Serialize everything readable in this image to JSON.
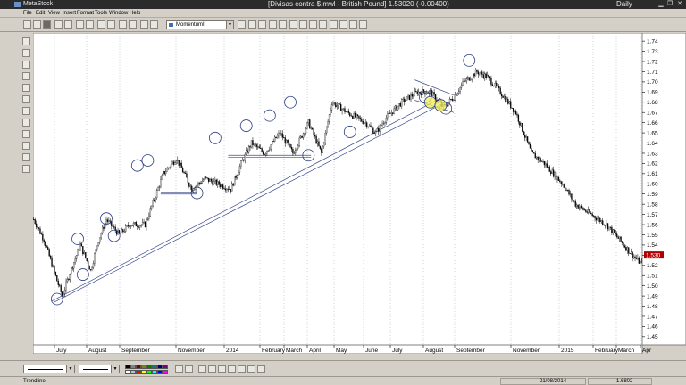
{
  "app": {
    "name": "MetaStock",
    "window_title": "[Divisas contra $.mwl - British Pound]   1.53020 (-0.00400)",
    "period": "Daily"
  },
  "menu": [
    "File",
    "Edit",
    "View",
    "Insert",
    "Format",
    "Tools",
    "Window",
    "Help"
  ],
  "toolbar": {
    "indicator_select": "MomentumI"
  },
  "chart_data": {
    "type": "candlestick",
    "symbol": "British Pound",
    "y_ticks": [
      "1.74",
      "1.73",
      "1.72",
      "1.71",
      "1.70",
      "1.69",
      "1.68",
      "1.67",
      "1.66",
      "1.65",
      "1.64",
      "1.63",
      "1.62",
      "1.61",
      "1.60",
      "1.59",
      "1.58",
      "1.57",
      "1.56",
      "1.55",
      "1.54",
      "1.53",
      "1.52",
      "1.51",
      "1.50",
      "1.49",
      "1.48",
      "1.47",
      "1.46",
      "1.45"
    ],
    "ylim": [
      1.442,
      1.748
    ],
    "x_labels": [
      "July",
      "August",
      "September",
      "November",
      "2014",
      "February",
      "March",
      "April",
      "May",
      "June",
      "July",
      "August",
      "September",
      "November",
      "2015",
      "February",
      "March",
      "Apr"
    ],
    "last_price_label": "1.530",
    "last_price": 1.5302,
    "bar_count": 470,
    "keypoints": [
      [
        0,
        1.565
      ],
      [
        8,
        1.545
      ],
      [
        18,
        1.505
      ],
      [
        22,
        1.49
      ],
      [
        30,
        1.52
      ],
      [
        36,
        1.54
      ],
      [
        44,
        1.515
      ],
      [
        50,
        1.545
      ],
      [
        56,
        1.565
      ],
      [
        66,
        1.55
      ],
      [
        74,
        1.56
      ],
      [
        86,
        1.56
      ],
      [
        100,
        1.61
      ],
      [
        110,
        1.625
      ],
      [
        122,
        1.595
      ],
      [
        132,
        1.605
      ],
      [
        142,
        1.6
      ],
      [
        152,
        1.595
      ],
      [
        160,
        1.62
      ],
      [
        168,
        1.64
      ],
      [
        178,
        1.63
      ],
      [
        190,
        1.65
      ],
      [
        200,
        1.63
      ],
      [
        212,
        1.66
      ],
      [
        222,
        1.63
      ],
      [
        230,
        1.68
      ],
      [
        242,
        1.67
      ],
      [
        256,
        1.66
      ],
      [
        264,
        1.65
      ],
      [
        272,
        1.665
      ],
      [
        284,
        1.68
      ],
      [
        296,
        1.69
      ],
      [
        306,
        1.69
      ],
      [
        316,
        1.675
      ],
      [
        324,
        1.685
      ],
      [
        332,
        1.7
      ],
      [
        342,
        1.71
      ],
      [
        350,
        1.705
      ],
      [
        360,
        1.69
      ],
      [
        372,
        1.67
      ],
      [
        384,
        1.63
      ],
      [
        394,
        1.62
      ],
      [
        408,
        1.6
      ],
      [
        418,
        1.58
      ],
      [
        430,
        1.57
      ],
      [
        442,
        1.56
      ],
      [
        452,
        1.545
      ],
      [
        462,
        1.53
      ],
      [
        470,
        1.52
      ],
      [
        482,
        1.51
      ],
      [
        494,
        1.51
      ],
      [
        506,
        1.52
      ],
      [
        518,
        1.53
      ],
      [
        528,
        1.54
      ],
      [
        536,
        1.51
      ],
      [
        542,
        1.49
      ],
      [
        548,
        1.48
      ]
    ],
    "peak_circles": [
      {
        "date_index": 18,
        "price": 1.487
      },
      {
        "date_index": 34,
        "price": 1.546
      },
      {
        "date_index": 38,
        "price": 1.511
      },
      {
        "date_index": 56,
        "price": 1.566
      },
      {
        "date_index": 62,
        "price": 1.549
      },
      {
        "date_index": 80,
        "price": 1.618
      },
      {
        "date_index": 88,
        "price": 1.623
      },
      {
        "date_index": 126,
        "price": 1.591
      },
      {
        "date_index": 140,
        "price": 1.645
      },
      {
        "date_index": 164,
        "price": 1.657
      },
      {
        "date_index": 182,
        "price": 1.667
      },
      {
        "date_index": 198,
        "price": 1.68
      },
      {
        "date_index": 212,
        "price": 1.628
      },
      {
        "date_index": 244,
        "price": 1.651
      },
      {
        "date_index": 302,
        "price": 1.685
      },
      {
        "date_index": 318,
        "price": 1.674
      },
      {
        "date_index": 336,
        "price": 1.721
      }
    ],
    "yellow_markers": [
      {
        "date_index": 306,
        "price": 1.68
      },
      {
        "date_index": 314,
        "price": 1.677
      }
    ],
    "trendlines": [
      {
        "from": [
          14,
          1.485
        ],
        "to": [
          314,
          1.684
        ]
      },
      {
        "from": [
          16,
          1.484
        ],
        "to": [
          316,
          1.679
        ]
      },
      {
        "from": [
          98,
          1.592
        ],
        "to": [
          126,
          1.592
        ]
      },
      {
        "from": [
          98,
          1.59
        ],
        "to": [
          126,
          1.59
        ]
      },
      {
        "from": [
          150,
          1.628
        ],
        "to": [
          214,
          1.628
        ]
      },
      {
        "from": [
          150,
          1.626
        ],
        "to": [
          214,
          1.626
        ]
      },
      {
        "from": [
          294,
          1.702
        ],
        "to": [
          324,
          1.687
        ]
      },
      {
        "from": [
          294,
          1.682
        ],
        "to": [
          324,
          1.67
        ]
      }
    ]
  },
  "bottombar": {
    "swatches": [
      "#000000",
      "#808080",
      "#800000",
      "#808000",
      "#008000",
      "#008080",
      "#000080",
      "#800080",
      "#ffffff",
      "#c0c0c0",
      "#ff0000",
      "#ffff00",
      "#00ff00",
      "#00ffff",
      "#0000ff",
      "#ff00ff"
    ]
  },
  "status": {
    "left": "Trendline",
    "date": "21/08/2014",
    "value": "1.6802"
  }
}
